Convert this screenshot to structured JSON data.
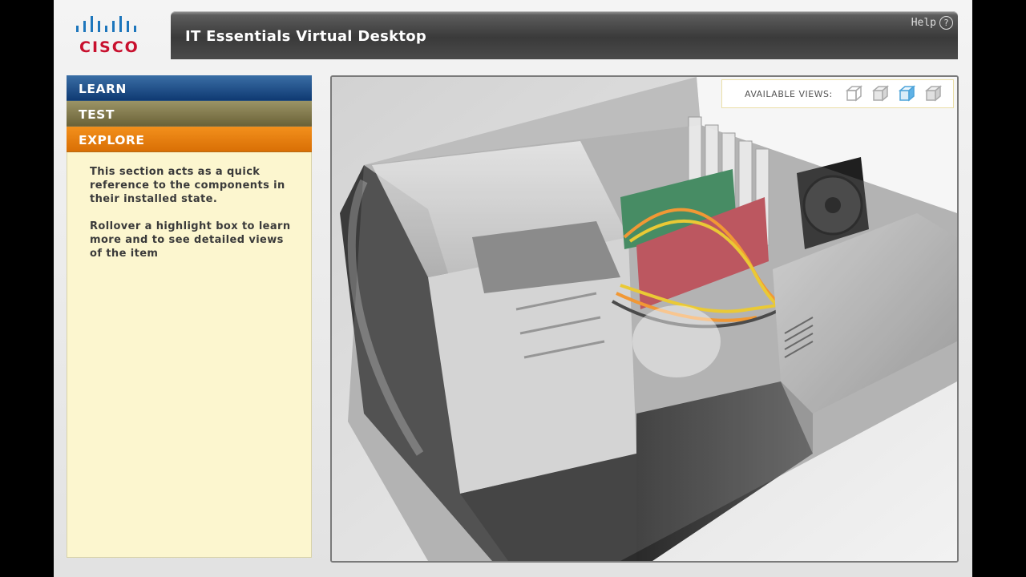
{
  "brand": {
    "logo_text": "CISCO"
  },
  "header": {
    "title": "IT Essentials Virtual Desktop",
    "help_label": "Help",
    "help_icon_glyph": "?"
  },
  "menu": {
    "items": [
      {
        "label": "LEARN",
        "color": "#1f4e8c"
      },
      {
        "label": "TEST",
        "color": "#857c4e"
      },
      {
        "label": "EXPLORE",
        "color": "#e67e0e",
        "active": true
      }
    ]
  },
  "info": {
    "paragraph1": "This section acts as a quick reference to the components in their installed state.",
    "paragraph2": "Rollover a highlight box to learn more and to see detailed views of the item"
  },
  "viewer": {
    "available_views_label": "AVAILABLE VIEWS:",
    "views": [
      {
        "name": "view-1",
        "active": false
      },
      {
        "name": "view-2",
        "active": false
      },
      {
        "name": "view-3",
        "active": true
      },
      {
        "name": "view-4",
        "active": false
      }
    ]
  }
}
